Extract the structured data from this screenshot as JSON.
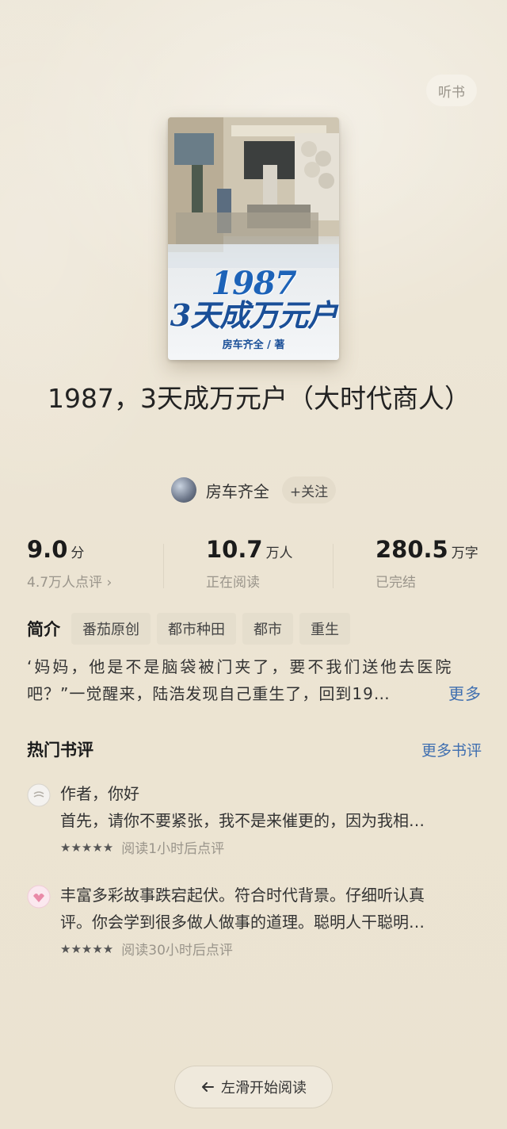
{
  "header": {
    "listen_label": "听书"
  },
  "cover": {
    "title_line1": "1987",
    "title_line2": "3天成万元户",
    "author_line": "房车齐全 / 著"
  },
  "book": {
    "title": "1987，3天成万元户（大时代商人）"
  },
  "author": {
    "name": "房车齐全",
    "follow_label": "+关注"
  },
  "stats": [
    {
      "value": "9.0",
      "unit": "分",
      "sub": "4.7万人点评 ›"
    },
    {
      "value": "10.7",
      "unit": "万人",
      "sub": "正在阅读"
    },
    {
      "value": "280.5",
      "unit": "万字",
      "sub": "已完结"
    }
  ],
  "intro": {
    "label": "简介",
    "tags": [
      "番茄原创",
      "都市种田",
      "都市",
      "重生"
    ],
    "line1": "‘妈妈，他是不是脑袋被门夹了，要不我们送他去医院",
    "line2": "吧？”一觉醒来，陆浩发现自己重生了，回到19…",
    "more_label": "更多"
  },
  "reviews_section": {
    "title": "热门书评",
    "more_label": "更多书评"
  },
  "reviews": [
    {
      "line1": "作者，你好",
      "line2": "首先，请你不要紧张，我不是来催更的，因为我相…",
      "stars": "★★★★★",
      "meta": "阅读1小时后点评"
    },
    {
      "line1": "丰富多彩故事跌宕起伏。符合时代背景。仔细听认真",
      "line2": "评。你会学到很多做人做事的道理。聪明人干聪明…",
      "stars": "★★★★★",
      "meta": "阅读30小时后点评"
    }
  ],
  "footer": {
    "start_label": "左滑开始阅读",
    "arrow_icon": "arrow-left-icon"
  },
  "colors": {
    "background": "#ede6d6",
    "link": "#3f6fb0",
    "muted": "#9a958b",
    "cover_title": "#1d63b8"
  }
}
